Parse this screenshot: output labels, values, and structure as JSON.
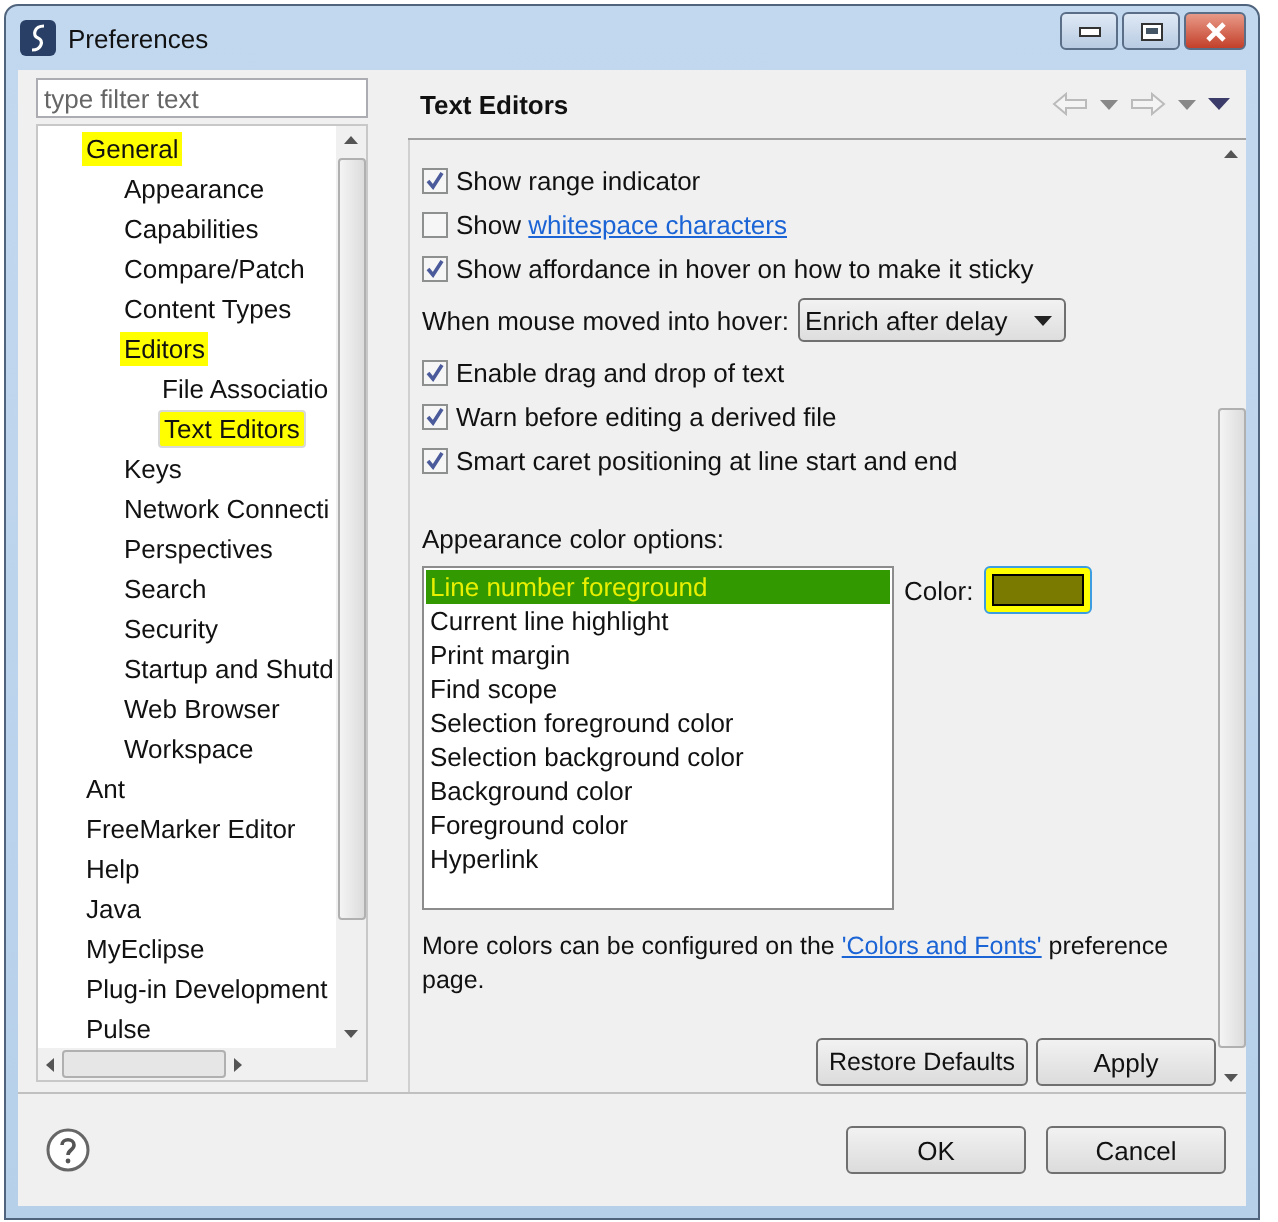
{
  "window": {
    "title": "Preferences"
  },
  "filter": {
    "placeholder": "type filter text"
  },
  "tree": [
    {
      "label": "General",
      "selected": false,
      "highlighted": true,
      "children": [
        {
          "label": "Appearance",
          "selected": false,
          "highlighted": false
        },
        {
          "label": "Capabilities",
          "selected": false,
          "highlighted": false
        },
        {
          "label": "Compare/Patch",
          "selected": false,
          "highlighted": false
        },
        {
          "label": "Content Types",
          "selected": false,
          "highlighted": false
        },
        {
          "label": "Editors",
          "selected": false,
          "highlighted": true,
          "children": [
            {
              "label": "File Associatio",
              "selected": false,
              "highlighted": false
            },
            {
              "label": "Text Editors",
              "selected": true,
              "highlighted": true
            }
          ]
        },
        {
          "label": "Keys",
          "selected": false,
          "highlighted": false
        },
        {
          "label": "Network Connecti",
          "selected": false,
          "highlighted": false
        },
        {
          "label": "Perspectives",
          "selected": false,
          "highlighted": false
        },
        {
          "label": "Search",
          "selected": false,
          "highlighted": false
        },
        {
          "label": "Security",
          "selected": false,
          "highlighted": false
        },
        {
          "label": "Startup and Shutd",
          "selected": false,
          "highlighted": false
        },
        {
          "label": "Web Browser",
          "selected": false,
          "highlighted": false
        },
        {
          "label": "Workspace",
          "selected": false,
          "highlighted": false
        }
      ]
    },
    {
      "label": "Ant",
      "selected": false,
      "highlighted": false
    },
    {
      "label": "FreeMarker Editor",
      "selected": false,
      "highlighted": false
    },
    {
      "label": "Help",
      "selected": false,
      "highlighted": false
    },
    {
      "label": "Java",
      "selected": false,
      "highlighted": false
    },
    {
      "label": "MyEclipse",
      "selected": false,
      "highlighted": false
    },
    {
      "label": "Plug-in Development",
      "selected": false,
      "highlighted": false
    },
    {
      "label": "Pulse",
      "selected": false,
      "highlighted": false
    }
  ],
  "page": {
    "title": "Text Editors",
    "options": [
      {
        "kind": "checkbox",
        "label": "Show range indicator",
        "checked": true
      },
      {
        "kind": "checkbox",
        "label": "Show",
        "link": "whitespace characters",
        "checked": false
      },
      {
        "kind": "checkbox",
        "label": "Show affordance in hover on how to make it sticky",
        "checked": true
      },
      {
        "kind": "dropdown",
        "label": "When mouse moved into hover:",
        "value": "Enrich after delay"
      },
      {
        "kind": "checkbox",
        "label": "Enable drag and drop of text",
        "checked": true
      },
      {
        "kind": "checkbox",
        "label": "Warn before editing a derived file",
        "checked": true
      },
      {
        "kind": "checkbox",
        "label": "Smart caret positioning at line start and end",
        "checked": true
      }
    ],
    "appearance": {
      "label": "Appearance color options:",
      "items": [
        {
          "label": "Line number foreground",
          "selected": true,
          "highlighted": true
        },
        {
          "label": "Current line highlight",
          "selected": false,
          "highlighted": false
        },
        {
          "label": "Print margin",
          "selected": false,
          "highlighted": false
        },
        {
          "label": "Find scope",
          "selected": false,
          "highlighted": false
        },
        {
          "label": "Selection foreground color",
          "selected": false,
          "highlighted": false
        },
        {
          "label": "Selection background color",
          "selected": false,
          "highlighted": false
        },
        {
          "label": "Background color",
          "selected": false,
          "highlighted": false
        },
        {
          "label": "Foreground color",
          "selected": false,
          "highlighted": false
        },
        {
          "label": "Hyperlink",
          "selected": false,
          "highlighted": false
        }
      ],
      "color_label": "Color:",
      "color": "#7a7a00",
      "color_highlighted": true
    },
    "note": {
      "before": "More colors can be configured on the ",
      "link": "'Colors and Fonts'",
      "after": " preference page."
    },
    "buttons": [
      "Restore Defaults",
      "Apply"
    ]
  },
  "dialog_buttons": [
    "OK",
    "Cancel"
  ]
}
